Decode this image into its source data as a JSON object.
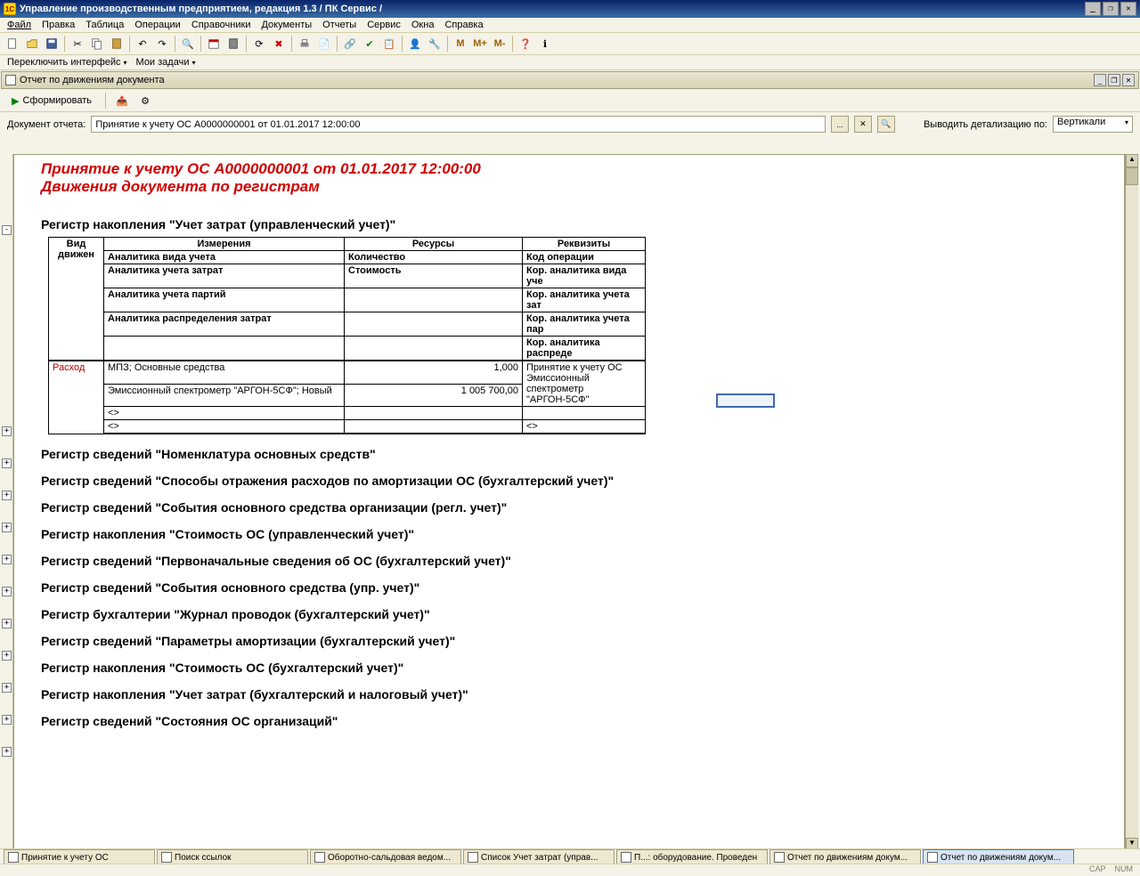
{
  "title": "Управление производственным предприятием, редакция 1.3 / ПК Сервис /",
  "menu": [
    "Файл",
    "Правка",
    "Таблица",
    "Операции",
    "Справочники",
    "Документы",
    "Отчеты",
    "Сервис",
    "Окна",
    "Справка"
  ],
  "toolbar2": {
    "switch": "Переключить интерфейс",
    "tasks": "Мои задачи"
  },
  "docwin_title": "Отчет по движениям документа",
  "form_btn": "Сформировать",
  "param": {
    "label": "Документ отчета:",
    "value": "Принятие к учету ОС А0000000001 от 01.01.2017 12:00:00",
    "detail_label": "Выводить детализацию по:",
    "detail_value": "Вертикали"
  },
  "report": {
    "title": "Принятие к учету ОС А0000000001 от 01.01.2017 12:00:00",
    "subtitle": "Движения документа по регистрам",
    "reg1": {
      "head": "Регистр накопления \"Учет затрат (управленческий учет)\"",
      "cols": {
        "c1": "Вид движен",
        "c2": "Измерения",
        "c3": "Ресурсы",
        "c4": "Реквизиты"
      },
      "subcols": {
        "r1c2": "Аналитика вида учета",
        "r1c3": "Количество",
        "r1c4": "Код операции",
        "r2c2": "Аналитика учета затрат",
        "r2c3": "Стоимость",
        "r2c4": "Кор. аналитика вида уче",
        "r3c2": "Аналитика учета партий",
        "r3c4": "Кор. аналитика учета зат",
        "r4c2": "Аналитика распределения затрат",
        "r4c4": "Кор. аналитика учета пар",
        "r5c4": "Кор. аналитика распреде"
      },
      "data": {
        "kind": "Расход",
        "d1": "МПЗ; Основные средства",
        "q1": "1,000",
        "r1": "Принятие к учету ОС",
        "d2": "Эмиссионный спектрометр \"АРГОН-5СФ\"; Новый",
        "q2": "1 005 700,00",
        "r2": "Эмиссионный спектрометр \"АРГОН-5СФ\"",
        "d3": "<>",
        "r3": "",
        "d4": "<>",
        "r4": "<>"
      }
    },
    "sections": [
      "Регистр сведений \"Номенклатура основных средств\"",
      "Регистр сведений \"Способы отражения расходов по амортизации ОС (бухгалтерский учет)\"",
      "Регистр сведений \"События основного средства организации (регл. учет)\"",
      "Регистр накопления \"Стоимость ОС (управленческий учет)\"",
      "Регистр сведений \"Первоначальные сведения об ОС (бухгалтерский учет)\"",
      "Регистр сведений \"События основного средства (упр. учет)\"",
      "Регистр бухгалтерии \"Журнал проводок (бухгалтерский учет)\"",
      "Регистр сведений \"Параметры амортизации (бухгалтерский учет)\"",
      "Регистр накопления \"Стоимость ОС (бухгалтерский учет)\"",
      "Регистр накопления \"Учет затрат (бухгалтерский и налоговый учет)\"",
      "Регистр сведений \"Состояния ОС организаций\""
    ]
  },
  "tabs": [
    "Принятие к учету ОС",
    "Поиск ссылок",
    "Оборотно-сальдовая ведом...",
    "Список Учет затрат (управ...",
    "П...: оборудование. Проведен",
    "Отчет по движениям докум...",
    "Отчет по движениям докум..."
  ],
  "status": {
    "cap": "CAP",
    "num": "NUM"
  }
}
